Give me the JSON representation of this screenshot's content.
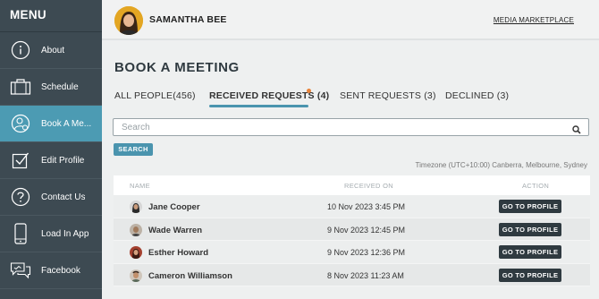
{
  "sidebar": {
    "title": "MENU",
    "items": [
      {
        "label": "About",
        "icon": "info-icon"
      },
      {
        "label": "Schedule",
        "icon": "briefcase-icon"
      },
      {
        "label": "Book A Me...",
        "icon": "meeting-person-icon",
        "active": true
      },
      {
        "label": "Edit Profile",
        "icon": "checkbox-edit-icon"
      },
      {
        "label": "Contact Us",
        "icon": "question-icon"
      },
      {
        "label": "Load In App",
        "icon": "phone-icon"
      },
      {
        "label": "Facebook",
        "icon": "chat-icon"
      }
    ],
    "bg_color": "#3d4a52",
    "active_color": "#4c9bb3"
  },
  "header": {
    "user_name": "SAMANTHA BEE",
    "link": "MEDIA MARKETPLACE"
  },
  "main": {
    "title": "BOOK A MEETING",
    "tabs": [
      {
        "label": "ALL PEOPLE(456)"
      },
      {
        "label": "RECEIVED REQUESTS (4)",
        "active": true
      },
      {
        "label": "SENT REQUESTS (3)"
      },
      {
        "label": "DECLINED (3)"
      }
    ],
    "search": {
      "placeholder": "Search",
      "value": "",
      "button": "SEARCH"
    },
    "timezone": "Timezone (UTC+10:00) Canberra, Melbourne, Sydney",
    "table": {
      "columns": [
        "NAME",
        "RECEIVED ON",
        "ACTION"
      ],
      "rows": [
        {
          "name": "Jane Cooper",
          "received": "10 Nov 2023 3:45 PM",
          "action": "GO TO PROFILE"
        },
        {
          "name": "Wade Warren",
          "received": "9 Nov 2023 12:45 PM",
          "action": "GO TO PROFILE"
        },
        {
          "name": "Esther Howard",
          "received": "9 Nov 2023 12:36 PM",
          "action": "GO TO PROFILE"
        },
        {
          "name": "Cameron Williamson",
          "received": "8 Nov 2023 11:23 AM",
          "action": "GO TO PROFILE"
        }
      ]
    },
    "accent_color": "#4a94ae"
  }
}
